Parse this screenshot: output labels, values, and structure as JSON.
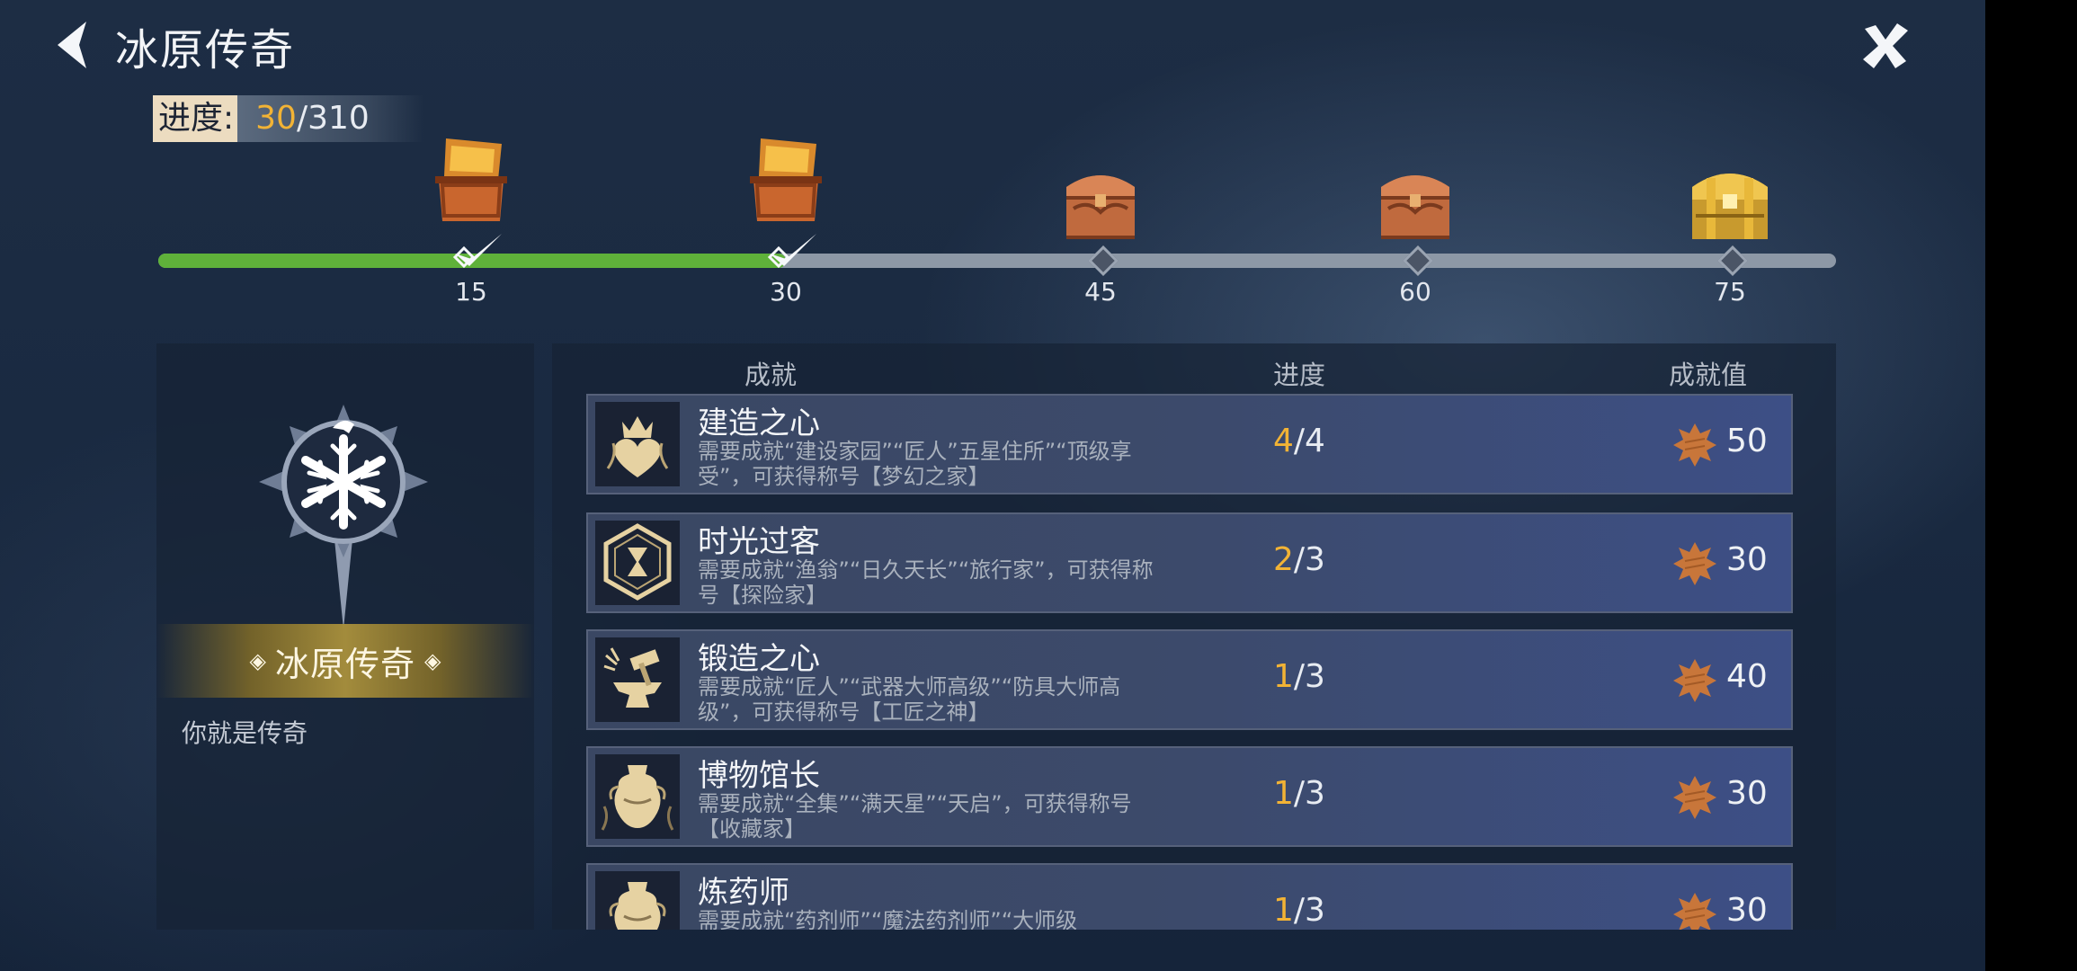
{
  "header": {
    "title": "冰原传奇"
  },
  "progress": {
    "label": "进度:",
    "current": "30",
    "sep_total": "/310",
    "fraction": 0.387
  },
  "milestones": [
    {
      "value": "15",
      "claimed": true,
      "chest": "orange"
    },
    {
      "value": "30",
      "claimed": true,
      "chest": "orange"
    },
    {
      "value": "45",
      "claimed": false,
      "chest": "copper"
    },
    {
      "value": "60",
      "claimed": false,
      "chest": "copper"
    },
    {
      "value": "75",
      "claimed": false,
      "chest": "gold"
    }
  ],
  "featured": {
    "name": "冰原传奇",
    "description": "你就是传奇",
    "icon": "snowflake-compass-emblem-icon"
  },
  "columns": {
    "name": "成就",
    "progress": "进度",
    "points": "成就值"
  },
  "achievements": [
    {
      "title": "建造之心",
      "desc": "需要成就“建设家园”“匠人”五星住所”“顶级享受”，可获得称号【梦幻之家】",
      "current": "4",
      "total": "/4",
      "points": "50",
      "icon": "crown-heart-icon"
    },
    {
      "title": "时光过客",
      "desc": "需要成就“渔翁”“日久天长”“旅行家”，可获得称号【探险家】",
      "current": "2",
      "total": "/3",
      "points": "30",
      "icon": "hourglass-hexagon-icon"
    },
    {
      "title": "锻造之心",
      "desc": "需要成就“匠人”“武器大师高级”“防具大师高级”，可获得称号【工匠之神】",
      "current": "1",
      "total": "/3",
      "points": "40",
      "icon": "anvil-hammer-icon"
    },
    {
      "title": "博物馆长",
      "desc": "需要成就“全集”“满天星”“天启”，可获得称号【收藏家】",
      "current": "1",
      "total": "/3",
      "points": "30",
      "icon": "vase-icon"
    },
    {
      "title": "炼药师",
      "desc": "需要成就“药剂师”“魔法药剂师”“大师级",
      "current": "1",
      "total": "/3",
      "points": "30",
      "icon": "vase-icon"
    }
  ],
  "colors": {
    "accent": "#f2b335",
    "bar_fill": "#5fb13a",
    "bar_track": "#8d98a6",
    "badge": "#c8763a"
  }
}
